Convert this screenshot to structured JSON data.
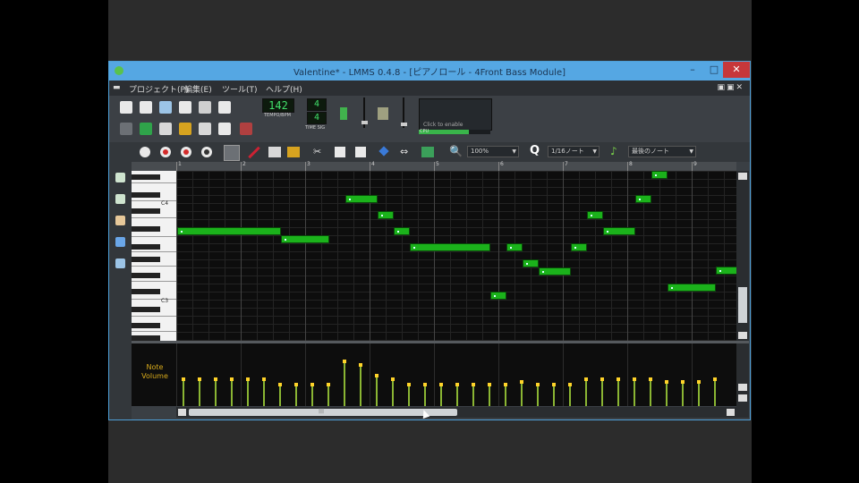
{
  "window": {
    "title": "Valentine* - LMMS 0.4.8 - [ピアノロール - 4Front Bass Module]",
    "btn_min": "–",
    "btn_max": "□",
    "btn_close": "✕"
  },
  "menu": [
    "プロジェクト(P)",
    "編集(E)",
    "ツール(T)",
    "ヘルプ(H)"
  ],
  "toolbar": {
    "tempo_value": "142",
    "tempo_label": "TEMPO/BPM",
    "timesig_top": "4",
    "timesig_bottom": "4",
    "timesig_label": "TIME SIG",
    "cpu_hint": "Click to enable",
    "cpu_label": "CPU"
  },
  "piano_roll_toolbar": {
    "zoom_value": "100%",
    "quant_value": "1/16ノート",
    "note_len_value": "最後のノート"
  },
  "ruler": [
    "1",
    "2",
    "3",
    "4",
    "5",
    "6",
    "7",
    "8",
    "9"
  ],
  "keyboard": {
    "octave_labels": [
      "C4",
      "C3"
    ]
  },
  "volume_label": "Note Volume",
  "scroll_label": "|||",
  "icons": [
    "new-icon",
    "open-icon",
    "save-icon",
    "export-icon",
    "play-icon",
    "record-icon",
    "stop-icon",
    "draw-icon",
    "erase-icon",
    "select-icon",
    "cut-icon",
    "copy-icon",
    "paste-icon",
    "zoom-icon",
    "quantize-icon",
    "note-icon"
  ],
  "colors": {
    "note": "#1bb21b",
    "volume_bar": "#8ab533",
    "volume_dot": "#ffd329",
    "titlebar": "#55a7e3",
    "close": "#c6373a"
  }
}
